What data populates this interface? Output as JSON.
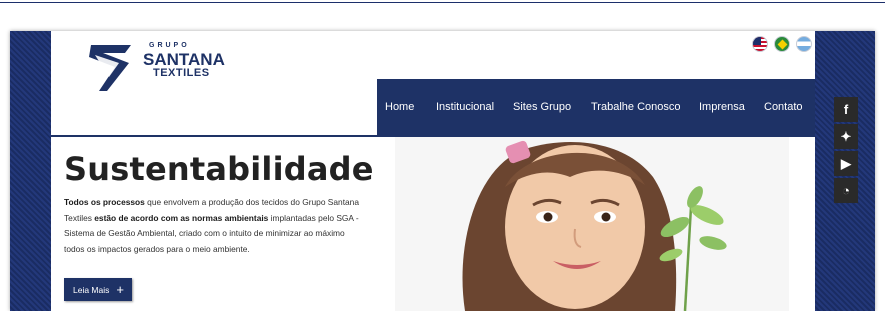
{
  "brand": {
    "grupo": "GRUPO",
    "name": "SANTANA",
    "sub": "TEXTILES",
    "color": "#1e3266"
  },
  "languages": [
    {
      "name": "english-flag-icon"
    },
    {
      "name": "portuguese-flag-icon"
    },
    {
      "name": "spanish-flag-icon"
    }
  ],
  "nav": {
    "items": [
      "Home",
      "Institucional",
      "Sites Grupo",
      "Trabalhe Conosco",
      "Imprensa",
      "Contato"
    ]
  },
  "hero": {
    "title": "Sustentabilidade",
    "p1_bold": "Todos os processos",
    "p1_rest": " que envolvem a produção dos tecidos do Grupo Santana Textiles ",
    "p2_bold": "estão de acordo com as normas ambientais",
    "p2_rest": " implantadas pelo SGA - Sistema de Gestão Ambiental, criado com o intuito de minimizar ao máximo todos os impactos gerados para o meio ambiente.",
    "button_label": "Leia Mais",
    "button_icon": "+"
  },
  "social": [
    {
      "name": "facebook-icon",
      "glyph": "f"
    },
    {
      "name": "twitter-icon",
      "glyph": "✦"
    },
    {
      "name": "youtube-icon",
      "glyph": "▶"
    },
    {
      "name": "rss-icon",
      "glyph": "◔"
    }
  ]
}
